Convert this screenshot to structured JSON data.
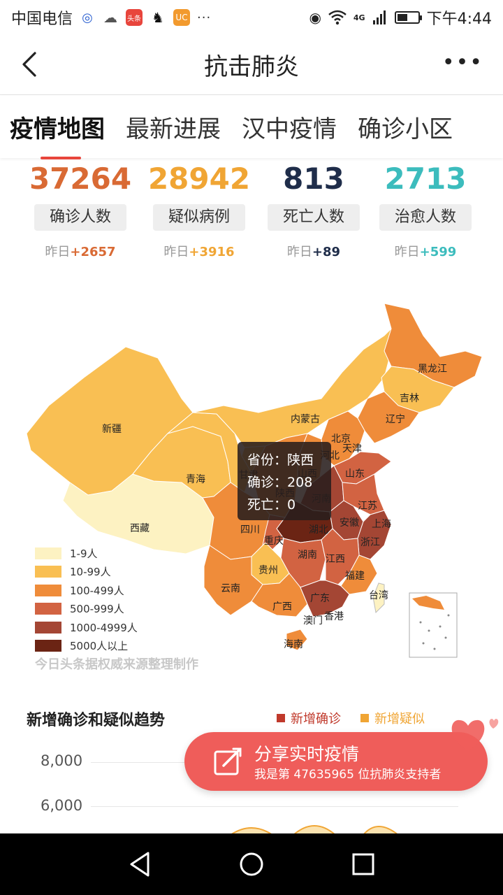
{
  "status_bar": {
    "carrier": "中国电信",
    "time": "下午4:44",
    "network": "4G",
    "icons": [
      "baidu-icon",
      "cloud-icon",
      "toutiao-icon",
      "qq-icon",
      "uc-browser-icon",
      "more-notifications-icon",
      "eye-icon",
      "wifi-icon",
      "signal-icon",
      "battery-icon"
    ]
  },
  "header": {
    "title": "抗击肺炎"
  },
  "tabs": [
    {
      "label": "疫情地图",
      "active": true
    },
    {
      "label": "最新进展",
      "active": false
    },
    {
      "label": "汉中疫情",
      "active": false
    },
    {
      "label": "确诊小区",
      "active": false
    }
  ],
  "stats": [
    {
      "value": "37264",
      "label": "确诊人数",
      "delta_prefix": "昨日",
      "delta": "+2657",
      "color": "#d96a34"
    },
    {
      "value": "28942",
      "label": "疑似病例",
      "delta_prefix": "昨日",
      "delta": "+3916",
      "color": "#f0a534"
    },
    {
      "value": "813",
      "label": "死亡人数",
      "delta_prefix": "昨日",
      "delta": "+89",
      "color": "#1f2d4a"
    },
    {
      "value": "2713",
      "label": "治愈人数",
      "delta_prefix": "昨日",
      "delta": "+599",
      "color": "#3cbcbd"
    }
  ],
  "map": {
    "province_labels": [
      "黑龙江",
      "吉林",
      "辽宁",
      "内蒙古",
      "新疆",
      "北京",
      "天津",
      "河北",
      "山东",
      "青海",
      "甘肃",
      "山西",
      "陕西",
      "河南",
      "江苏",
      "西藏",
      "四川",
      "湖北",
      "安徽",
      "上海",
      "重庆",
      "浙江",
      "湖南",
      "江西",
      "贵州",
      "福建",
      "云南",
      "广西",
      "广东",
      "台湾",
      "澳门",
      "香港",
      "海南"
    ],
    "tooltip": {
      "province_label": "省份：",
      "province": "陕西",
      "confirmed_label": "确诊：",
      "confirmed": "208",
      "deaths_label": "死亡：",
      "deaths": "0"
    },
    "legend": [
      {
        "label": "1-9人",
        "color": "#fdf2c2"
      },
      {
        "label": "10-99人",
        "color": "#f9bf53"
      },
      {
        "label": "100-499人",
        "color": "#ef8c3a"
      },
      {
        "label": "500-999人",
        "color": "#d26342"
      },
      {
        "label": "1000-4999人",
        "color": "#a44634"
      },
      {
        "label": "5000人以上",
        "color": "#6b2414"
      }
    ],
    "source": "今日头条据权威来源整理制作"
  },
  "trend": {
    "title": "新增确诊和疑似趋势",
    "legend": [
      {
        "label": "新增确诊",
        "color": "#c0392b"
      },
      {
        "label": "新增疑似",
        "color": "#f0a534"
      }
    ],
    "y_ticks": [
      "8,000",
      "6,000"
    ]
  },
  "share": {
    "title": "分享实时疫情",
    "subtitle": "我是第 47635965 位抗肺炎支持者"
  }
}
